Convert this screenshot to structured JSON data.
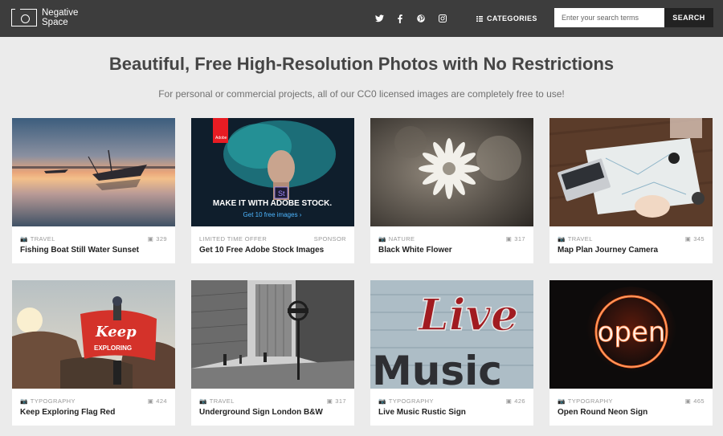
{
  "header": {
    "logo_line1": "Negative",
    "logo_line2": "Space",
    "social": [
      "twitter-icon",
      "facebook-icon",
      "pinterest-icon",
      "instagram-icon"
    ],
    "categories_label": "CATEGORIES",
    "search_placeholder": "Enter your search terms",
    "search_button": "SEARCH"
  },
  "hero": {
    "title": "Beautiful, Free High-Resolution Photos with No Restrictions",
    "subtitle": "For personal or commercial projects, all of our CC0 licensed images are completely free to use!"
  },
  "colors": {
    "header_bg": "#3d3d3d",
    "page_bg": "#ebebeb",
    "accent_blue": "#4db6ff",
    "adobe_red": "#e81c23"
  },
  "ad": {
    "badge": "Adobe",
    "logo_mark": "St",
    "headline": "MAKE IT WITH ADOBE STOCK.",
    "cta": "Get 10 free images ›"
  },
  "cards": [
    {
      "category": "TRAVEL",
      "count": "329",
      "title": "Fishing Boat Still Water Sunset"
    },
    {
      "category": "LIMITED TIME OFFER",
      "count": "SPONSOR",
      "title": "Get 10 Free Adobe Stock Images"
    },
    {
      "category": "NATURE",
      "count": "317",
      "title": "Black White Flower"
    },
    {
      "category": "TRAVEL",
      "count": "345",
      "title": "Map Plan Journey Camera"
    },
    {
      "category": "TYPOGRAPHY",
      "count": "424",
      "title": "Keep Exploring Flag Red"
    },
    {
      "category": "TRAVEL",
      "count": "317",
      "title": "Underground Sign London B&W"
    },
    {
      "category": "TYPOGRAPHY",
      "count": "426",
      "title": "Live Music Rustic Sign"
    },
    {
      "category": "TYPOGRAPHY",
      "count": "465",
      "title": "Open Round Neon Sign"
    }
  ],
  "photo_text": {
    "keep": "Keep",
    "exploring": "EXPLORING",
    "live": "Live",
    "music": "Music",
    "open": "open"
  }
}
